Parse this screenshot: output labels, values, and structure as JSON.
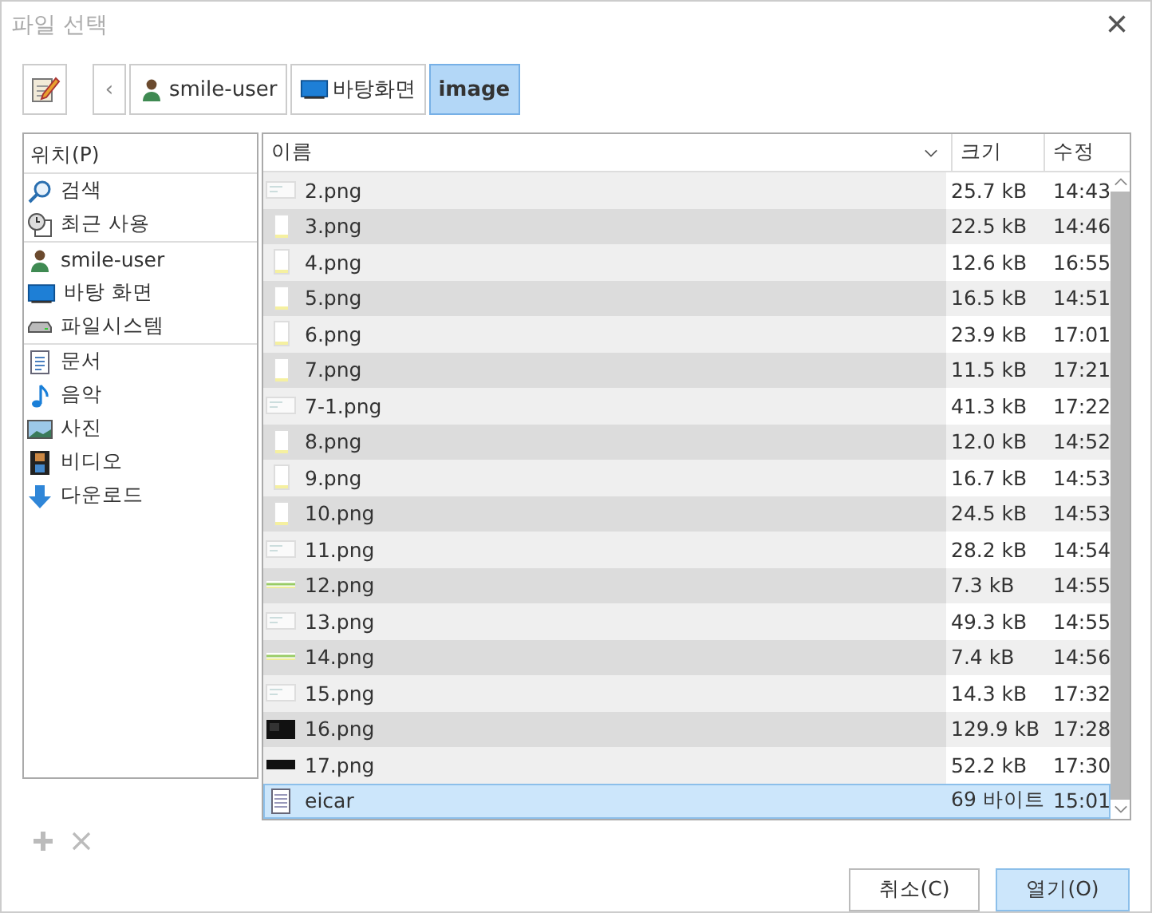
{
  "window": {
    "title": "파일 선택",
    "close": "×"
  },
  "toolbar": {
    "back": "‹",
    "crumbs": [
      {
        "label": "smile-user",
        "kind": "user",
        "selected": false
      },
      {
        "label": "바탕화면",
        "kind": "desktop",
        "selected": false
      },
      {
        "label": "image",
        "selected": true
      }
    ]
  },
  "sidebar": {
    "header": "위치(P)",
    "groups": [
      [
        {
          "label": "검색",
          "kind": "search"
        },
        {
          "label": "최근 사용",
          "kind": "recent"
        }
      ],
      [
        {
          "label": "smile-user",
          "kind": "user"
        },
        {
          "label": "바탕 화면",
          "kind": "desktop"
        },
        {
          "label": "파일시스템",
          "kind": "drive"
        }
      ],
      [
        {
          "label": "문서",
          "kind": "doc"
        },
        {
          "label": "음악",
          "kind": "music"
        },
        {
          "label": "사진",
          "kind": "photo"
        },
        {
          "label": "비디오",
          "kind": "video"
        },
        {
          "label": "다운로드",
          "kind": "download"
        }
      ]
    ]
  },
  "table": {
    "columns": [
      "이름",
      "크기",
      "수정"
    ],
    "rows": [
      {
        "name": "2.png",
        "size": "25.7 kB",
        "time": "14:43",
        "kind": "wide",
        "selected": false
      },
      {
        "name": "3.png",
        "size": "22.5 kB",
        "time": "14:46",
        "kind": "page",
        "selected": false
      },
      {
        "name": "4.png",
        "size": "12.6 kB",
        "time": "16:55",
        "kind": "page",
        "selected": false
      },
      {
        "name": "5.png",
        "size": "16.5 kB",
        "time": "14:51",
        "kind": "page",
        "selected": false
      },
      {
        "name": "6.png",
        "size": "23.9 kB",
        "time": "17:01",
        "kind": "page",
        "selected": false
      },
      {
        "name": "7.png",
        "size": "11.5 kB",
        "time": "17:21",
        "kind": "page",
        "selected": false
      },
      {
        "name": "7-1.png",
        "size": "41.3 kB",
        "time": "17:22",
        "kind": "wide",
        "selected": false
      },
      {
        "name": "8.png",
        "size": "12.0 kB",
        "time": "14:52",
        "kind": "page",
        "selected": false
      },
      {
        "name": "9.png",
        "size": "16.7 kB",
        "time": "14:53",
        "kind": "page",
        "selected": false
      },
      {
        "name": "10.png",
        "size": "24.5 kB",
        "time": "14:53",
        "kind": "page",
        "selected": false
      },
      {
        "name": "11.png",
        "size": "28.2 kB",
        "time": "14:54",
        "kind": "wide",
        "selected": false
      },
      {
        "name": "12.png",
        "size": "7.3 kB",
        "time": "14:55",
        "kind": "line",
        "selected": false
      },
      {
        "name": "13.png",
        "size": "49.3 kB",
        "time": "14:55",
        "kind": "wide",
        "selected": false
      },
      {
        "name": "14.png",
        "size": "7.4 kB",
        "time": "14:56",
        "kind": "line",
        "selected": false
      },
      {
        "name": "15.png",
        "size": "14.3 kB",
        "time": "17:32",
        "kind": "wide",
        "selected": false
      },
      {
        "name": "16.png",
        "size": "129.9 kB",
        "time": "17:28",
        "kind": "dark",
        "selected": false
      },
      {
        "name": "17.png",
        "size": "52.2 kB",
        "time": "17:30",
        "kind": "strip",
        "selected": false
      },
      {
        "name": "eicar",
        "size": "69 바이트",
        "time": "15:01",
        "kind": "text",
        "selected": true
      }
    ]
  },
  "buttons": [
    {
      "label": "취소(C)",
      "default": false
    },
    {
      "label": "열기(O)",
      "default": true
    }
  ]
}
